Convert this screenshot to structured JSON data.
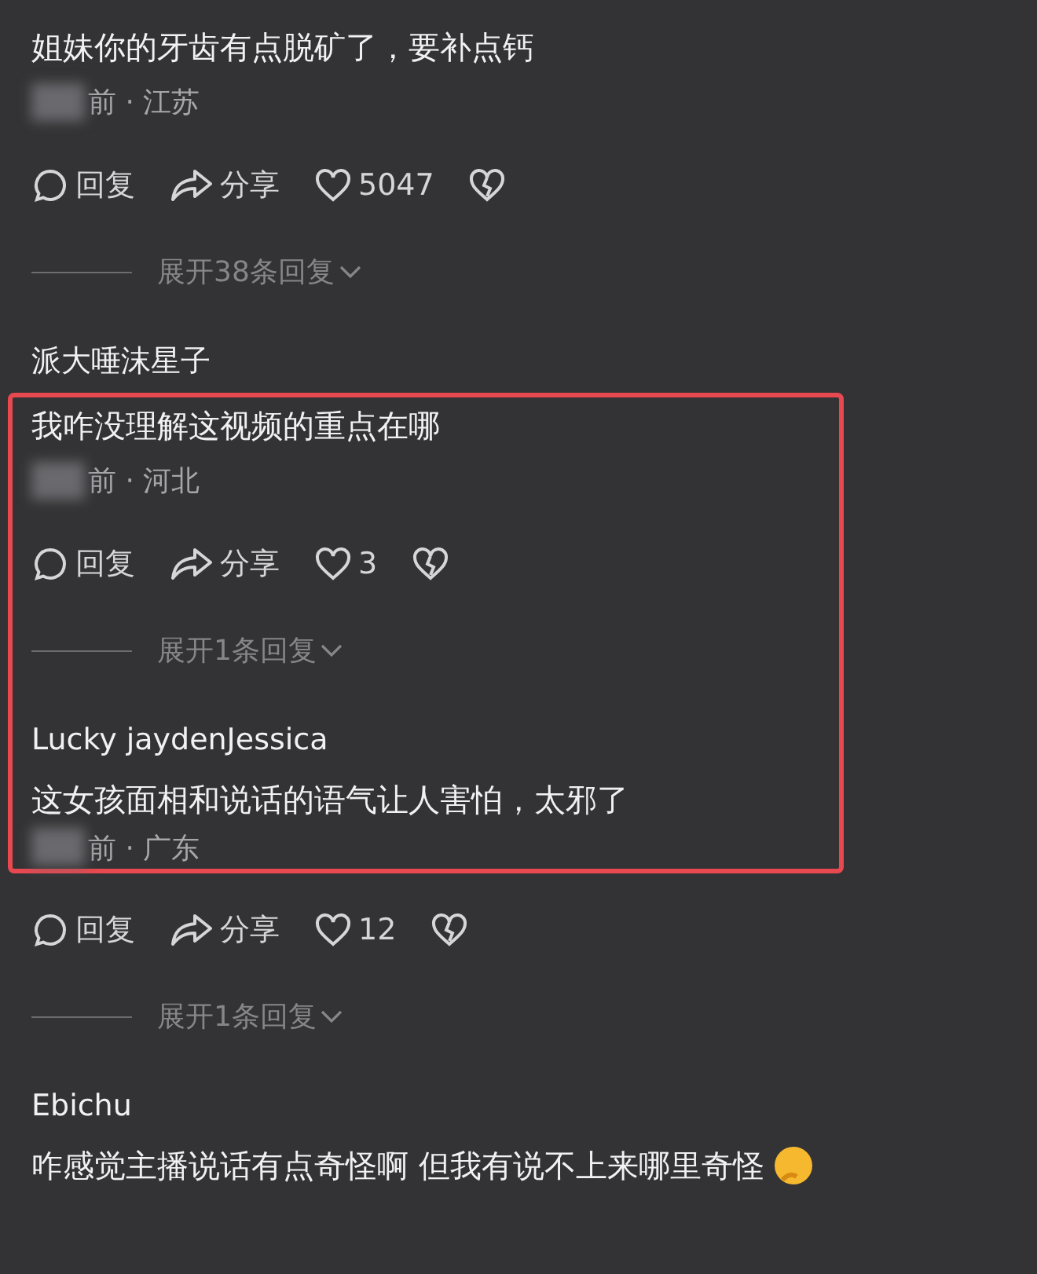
{
  "comments": [
    {
      "text": "姐妹你的牙齿有点脱矿了，要补点钙",
      "meta": "前 · 江苏",
      "highlighted": false,
      "actions": {
        "reply": "回复",
        "share": "分享",
        "likes": "5047"
      },
      "expand": "展开38条回复"
    },
    {
      "author": "派大唾沫星子",
      "text": "我咋没理解这视频的重点在哪",
      "meta": "前 · 河北",
      "highlighted": true,
      "actions": {
        "reply": "回复",
        "share": "分享",
        "likes": "3"
      },
      "expand": "展开1条回复"
    },
    {
      "author": "Lucky jaydenJessica",
      "text": "这女孩面相和说话的语气让人害怕，太邪了",
      "meta": "前 · 广东",
      "highlighted": true,
      "actions": {
        "reply": "回复",
        "share": "分享",
        "likes": "12"
      },
      "expand": "展开1条回复"
    },
    {
      "author": "Ebichu",
      "text": "咋感觉主播说话有点奇怪啊 但我有说不上来哪里奇怪",
      "emoji": true,
      "highlighted": false
    }
  ]
}
